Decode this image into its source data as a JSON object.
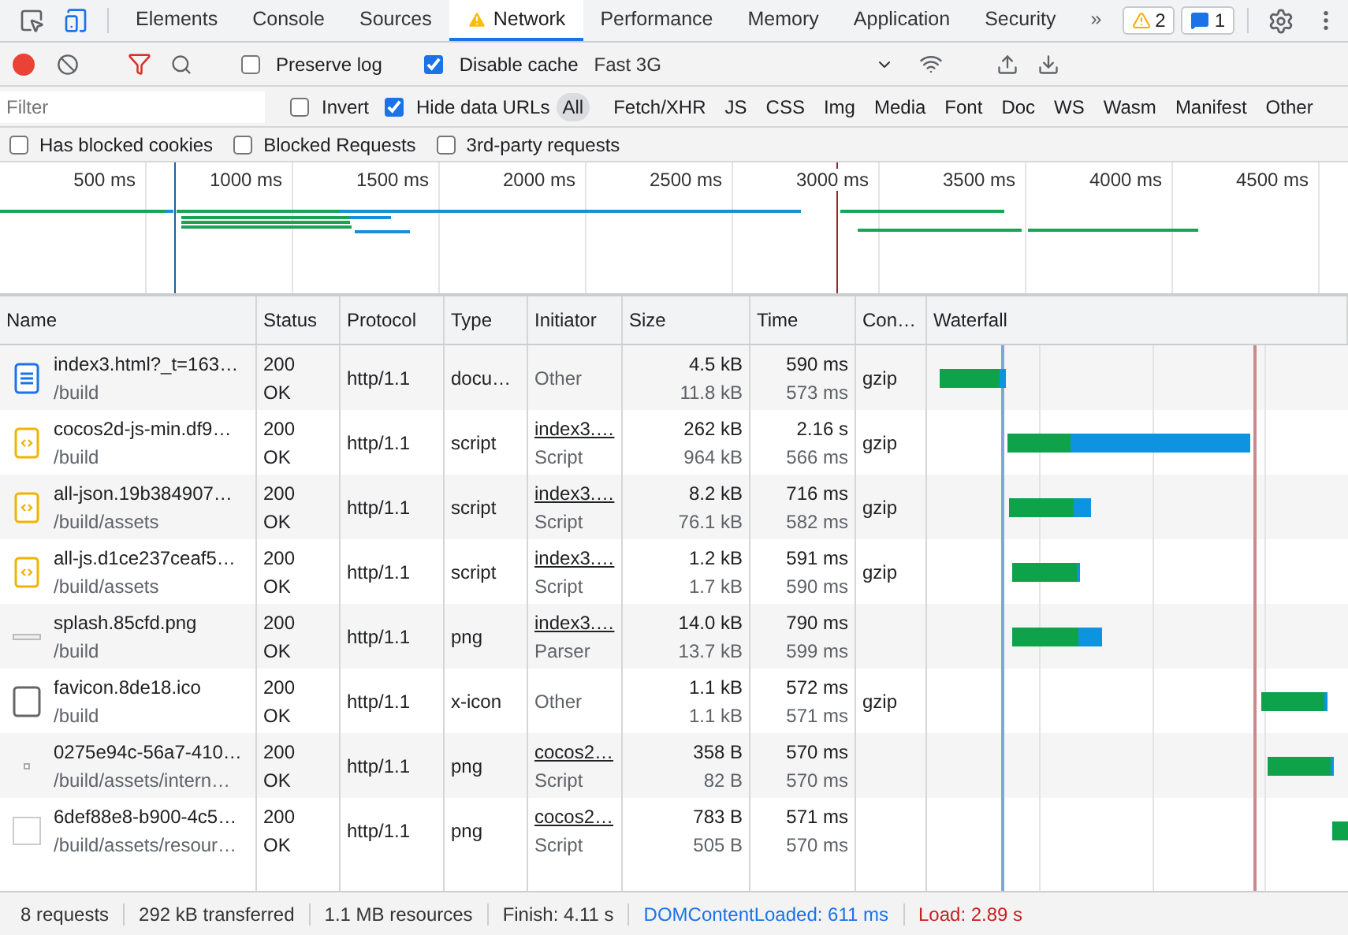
{
  "tabs": [
    {
      "label": "Elements",
      "selected": false,
      "warning": false
    },
    {
      "label": "Console",
      "selected": false,
      "warning": false
    },
    {
      "label": "Sources",
      "selected": false,
      "warning": false
    },
    {
      "label": "Network",
      "selected": true,
      "warning": true
    },
    {
      "label": "Performance",
      "selected": false,
      "warning": false
    },
    {
      "label": "Memory",
      "selected": false,
      "warning": false
    },
    {
      "label": "Application",
      "selected": false,
      "warning": false
    },
    {
      "label": "Security",
      "selected": false,
      "warning": false
    }
  ],
  "more_tabs": "»",
  "issue_badges": [
    {
      "kind": "warning",
      "count": "2"
    },
    {
      "kind": "message",
      "count": "1"
    }
  ],
  "toolbar": {
    "recording": true,
    "preserve_log": {
      "label": "Preserve log",
      "checked": false
    },
    "disable_cache": {
      "label": "Disable cache",
      "checked": true
    },
    "throttling": "Fast 3G"
  },
  "filter_bar": {
    "placeholder": "Filter",
    "invert": {
      "label": "Invert",
      "checked": false
    },
    "hide_data_urls": {
      "label": "Hide data URLs",
      "checked": true
    },
    "types": [
      {
        "label": "All",
        "selected": true
      },
      {
        "label": "Fetch/XHR",
        "selected": false
      },
      {
        "label": "JS",
        "selected": false
      },
      {
        "label": "CSS",
        "selected": false
      },
      {
        "label": "Img",
        "selected": false
      },
      {
        "label": "Media",
        "selected": false
      },
      {
        "label": "Font",
        "selected": false
      },
      {
        "label": "Doc",
        "selected": false
      },
      {
        "label": "WS",
        "selected": false
      },
      {
        "label": "Wasm",
        "selected": false
      },
      {
        "label": "Manifest",
        "selected": false
      },
      {
        "label": "Other",
        "selected": false
      }
    ]
  },
  "extra_filters": [
    {
      "label": "Has blocked cookies",
      "checked": false
    },
    {
      "label": "Blocked Requests",
      "checked": false
    },
    {
      "label": "3rd-party requests",
      "checked": false
    }
  ],
  "overview": {
    "ticks": [
      "500 ms",
      "1000 ms",
      "1500 ms",
      "2000 ms",
      "2500 ms",
      "3000 ms",
      "3500 ms",
      "4000 ms",
      "4500 ms"
    ]
  },
  "table": {
    "columns": [
      "Name",
      "Status",
      "Protocol",
      "Type",
      "Initiator",
      "Size",
      "Time",
      "Con…",
      "Waterfall"
    ],
    "rows": [
      {
        "kind": "document",
        "name": "index3.html?_t=163…",
        "path": "/build",
        "status": "200",
        "status_text": "OK",
        "protocol": "http/1.1",
        "type": "docu…",
        "initiator": {
          "text": "Other",
          "link": false
        },
        "size": "4.5 kB",
        "resource_size": "11.8 kB",
        "time": "590 ms",
        "latency": "573 ms",
        "encoding": "gzip"
      },
      {
        "kind": "script",
        "name": "cocos2d-js-min.df9…",
        "path": "/build",
        "status": "200",
        "status_text": "OK",
        "protocol": "http/1.1",
        "type": "script",
        "initiator": {
          "text": "index3.…",
          "link": true,
          "cause": "Script"
        },
        "size": "262 kB",
        "resource_size": "964 kB",
        "time": "2.16 s",
        "latency": "566 ms",
        "encoding": "gzip"
      },
      {
        "kind": "script",
        "name": "all-json.19b384907…",
        "path": "/build/assets",
        "status": "200",
        "status_text": "OK",
        "protocol": "http/1.1",
        "type": "script",
        "initiator": {
          "text": "index3.…",
          "link": true,
          "cause": "Script"
        },
        "size": "8.2 kB",
        "resource_size": "76.1 kB",
        "time": "716 ms",
        "latency": "582 ms",
        "encoding": "gzip"
      },
      {
        "kind": "script",
        "name": "all-js.d1ce237ceaf5…",
        "path": "/build/assets",
        "status": "200",
        "status_text": "OK",
        "protocol": "http/1.1",
        "type": "script",
        "initiator": {
          "text": "index3.…",
          "link": true,
          "cause": "Script"
        },
        "size": "1.2 kB",
        "resource_size": "1.7 kB",
        "time": "591 ms",
        "latency": "590 ms",
        "encoding": "gzip"
      },
      {
        "kind": "strip",
        "name": "splash.85cfd.png",
        "path": "/build",
        "status": "200",
        "status_text": "OK",
        "protocol": "http/1.1",
        "type": "png",
        "initiator": {
          "text": "index3.…",
          "link": true,
          "cause": "Parser"
        },
        "size": "14.0 kB",
        "resource_size": "13.7 kB",
        "time": "790 ms",
        "latency": "599 ms"
      },
      {
        "kind": "frame",
        "name": "favicon.8de18.ico",
        "path": "/build",
        "status": "200",
        "status_text": "OK",
        "protocol": "http/1.1",
        "type": "x-icon",
        "initiator": {
          "text": "Other",
          "link": false
        },
        "size": "1.1 kB",
        "resource_size": "1.1 kB",
        "time": "572 ms",
        "latency": "571 ms",
        "encoding": "gzip"
      },
      {
        "kind": "dot",
        "name": "0275e94c-56a7-410…",
        "path": "/build/assets/intern…",
        "status": "200",
        "status_text": "OK",
        "protocol": "http/1.1",
        "type": "png",
        "initiator": {
          "text": "cocos2…",
          "link": true,
          "cause": "Script"
        },
        "size": "358 B",
        "resource_size": "82 B",
        "time": "570 ms",
        "latency": "570 ms"
      },
      {
        "kind": "blank",
        "name": "6def88e8-b900-4c5…",
        "path": "/build/assets/resour…",
        "status": "200",
        "status_text": "OK",
        "protocol": "http/1.1",
        "type": "png",
        "initiator": {
          "text": "cocos2…",
          "link": true,
          "cause": "Script"
        },
        "size": "783 B",
        "resource_size": "505 B",
        "time": "571 ms",
        "latency": "570 ms"
      }
    ]
  },
  "status_bar": [
    {
      "kind": "plain",
      "text": "8 requests"
    },
    {
      "kind": "plain",
      "text": "292 kB transferred"
    },
    {
      "kind": "plain",
      "text": "1.1 MB resources"
    },
    {
      "kind": "plain",
      "text": "Finish: 4.11 s"
    },
    {
      "kind": "dom",
      "text": "DOMContentLoaded: 611 ms"
    },
    {
      "kind": "load",
      "text": "Load: 2.89 s"
    }
  ]
}
